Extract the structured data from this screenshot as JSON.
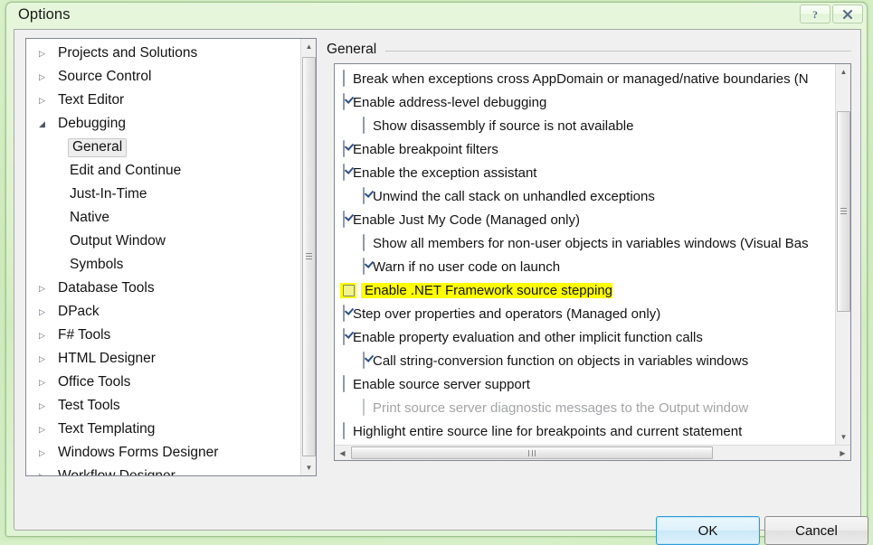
{
  "window": {
    "title": "Options",
    "help_button": "?",
    "close_button": "✕"
  },
  "tree": {
    "items": [
      {
        "label": "Projects and Solutions",
        "arrow": "▷",
        "level": 0,
        "expanded": false,
        "selected": false
      },
      {
        "label": "Source Control",
        "arrow": "▷",
        "level": 0,
        "expanded": false,
        "selected": false
      },
      {
        "label": "Text Editor",
        "arrow": "▷",
        "level": 0,
        "expanded": false,
        "selected": false
      },
      {
        "label": "Debugging",
        "arrow": "◢",
        "level": 0,
        "expanded": true,
        "selected": false
      },
      {
        "label": "General",
        "arrow": "",
        "level": 1,
        "expanded": false,
        "selected": true
      },
      {
        "label": "Edit and Continue",
        "arrow": "",
        "level": 1,
        "expanded": false,
        "selected": false
      },
      {
        "label": "Just-In-Time",
        "arrow": "",
        "level": 1,
        "expanded": false,
        "selected": false
      },
      {
        "label": "Native",
        "arrow": "",
        "level": 1,
        "expanded": false,
        "selected": false
      },
      {
        "label": "Output Window",
        "arrow": "",
        "level": 1,
        "expanded": false,
        "selected": false
      },
      {
        "label": "Symbols",
        "arrow": "",
        "level": 1,
        "expanded": false,
        "selected": false
      },
      {
        "label": "Database Tools",
        "arrow": "▷",
        "level": 0,
        "expanded": false,
        "selected": false
      },
      {
        "label": "DPack",
        "arrow": "▷",
        "level": 0,
        "expanded": false,
        "selected": false
      },
      {
        "label": "F# Tools",
        "arrow": "▷",
        "level": 0,
        "expanded": false,
        "selected": false
      },
      {
        "label": "HTML Designer",
        "arrow": "▷",
        "level": 0,
        "expanded": false,
        "selected": false
      },
      {
        "label": "Office Tools",
        "arrow": "▷",
        "level": 0,
        "expanded": false,
        "selected": false
      },
      {
        "label": "Test Tools",
        "arrow": "▷",
        "level": 0,
        "expanded": false,
        "selected": false
      },
      {
        "label": "Text Templating",
        "arrow": "▷",
        "level": 0,
        "expanded": false,
        "selected": false
      },
      {
        "label": "Windows Forms Designer",
        "arrow": "▷",
        "level": 0,
        "expanded": false,
        "selected": false
      },
      {
        "label": "Workflow Designer",
        "arrow": "▷",
        "level": 0,
        "expanded": false,
        "selected": false
      }
    ]
  },
  "content": {
    "section_title": "General",
    "options": [
      {
        "label": "Break when exceptions cross AppDomain or managed/native boundaries (N",
        "checked": false,
        "level": 0,
        "disabled": false,
        "highlighted": false
      },
      {
        "label": "Enable address-level debugging",
        "checked": true,
        "level": 0,
        "disabled": false,
        "highlighted": false
      },
      {
        "label": "Show disassembly if source is not available",
        "checked": false,
        "level": 1,
        "disabled": false,
        "highlighted": false
      },
      {
        "label": "Enable breakpoint filters",
        "checked": true,
        "level": 0,
        "disabled": false,
        "highlighted": false
      },
      {
        "label": "Enable the exception assistant",
        "checked": true,
        "level": 0,
        "disabled": false,
        "highlighted": false
      },
      {
        "label": "Unwind the call stack on unhandled exceptions",
        "checked": true,
        "level": 1,
        "disabled": false,
        "highlighted": false
      },
      {
        "label": "Enable Just My Code (Managed only)",
        "checked": true,
        "level": 0,
        "disabled": false,
        "highlighted": false
      },
      {
        "label": "Show all members for non-user objects in variables windows (Visual Bas",
        "checked": false,
        "level": 1,
        "disabled": false,
        "highlighted": false
      },
      {
        "label": "Warn if no user code on launch",
        "checked": true,
        "level": 1,
        "disabled": false,
        "highlighted": false
      },
      {
        "label": "Enable .NET Framework source stepping",
        "checked": false,
        "level": 0,
        "disabled": false,
        "highlighted": true
      },
      {
        "label": "Step over properties and operators (Managed only)",
        "checked": true,
        "level": 0,
        "disabled": false,
        "highlighted": false
      },
      {
        "label": "Enable property evaluation and other implicit function calls",
        "checked": true,
        "level": 0,
        "disabled": false,
        "highlighted": false
      },
      {
        "label": "Call string-conversion function on objects in variables windows",
        "checked": true,
        "level": 1,
        "disabled": false,
        "highlighted": false
      },
      {
        "label": "Enable source server support",
        "checked": false,
        "level": 0,
        "disabled": false,
        "highlighted": false
      },
      {
        "label": "Print source server diagnostic messages to the Output window",
        "checked": false,
        "level": 1,
        "disabled": true,
        "highlighted": false
      },
      {
        "label": "Highlight entire source line for breakpoints and current statement",
        "checked": false,
        "level": 0,
        "disabled": false,
        "highlighted": false
      }
    ]
  },
  "scrollbars": {
    "up_arrow": "▲",
    "down_arrow": "▼",
    "left_arrow": "◀",
    "right_arrow": "▶"
  },
  "footer": {
    "ok_label": "OK",
    "cancel_label": "Cancel"
  },
  "colors": {
    "highlight": "#ffff00",
    "titlebar": "#d8f0c8",
    "dialog_bg": "#f0f0f0",
    "accent": "#2f9ad6"
  }
}
